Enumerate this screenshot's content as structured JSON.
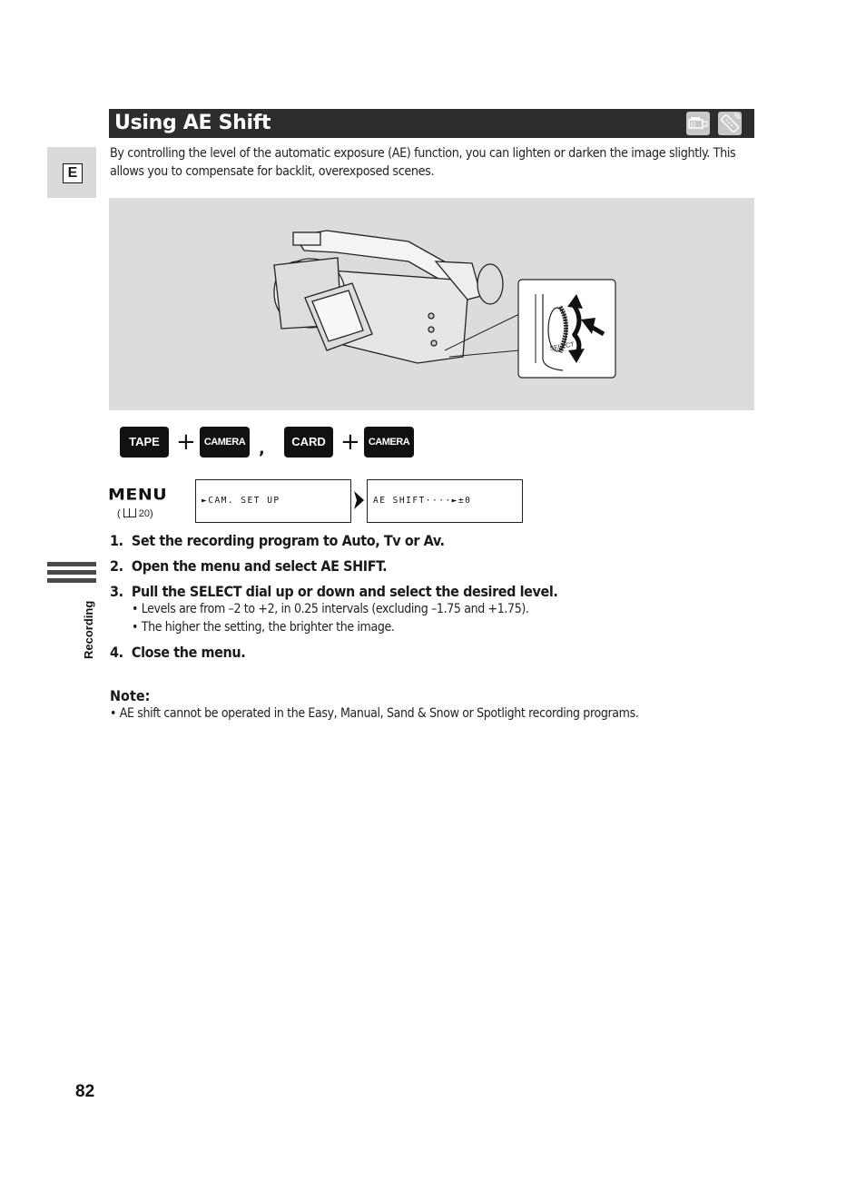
{
  "header": {
    "title": "Using AE Shift",
    "icons": [
      "camera-mode-icon",
      "remote-control-icon"
    ]
  },
  "language_tab": "E",
  "intro": "By controlling the level of the automatic exposure (AE) function, you can lighten or darken the image slightly. This allows you to compensate for backlit, overexposed scenes.",
  "illustration": {
    "description": "camcorder-with-select-dial-closeup",
    "dial_label": "SELECT"
  },
  "modes": {
    "group1": [
      "TAPE",
      "CAMERA"
    ],
    "group2": [
      "CARD",
      "CAMERA"
    ],
    "plus": "+",
    "separator": ","
  },
  "menu": {
    "label": "MENU",
    "reference": "( ☶ 20)",
    "ref_page": "20",
    "box1": "►CAM. SET UP",
    "box2": "AE SHIFT····►±0"
  },
  "steps": [
    {
      "num": "1.",
      "text": "Set the recording program to Auto, Tv or Av."
    },
    {
      "num": "2.",
      "text": "Open the menu and select AE SHIFT."
    },
    {
      "num": "3.",
      "text": "Pull the SELECT dial up or down and select the desired level."
    },
    {
      "num": "4.",
      "text": "Close the menu."
    }
  ],
  "step3_bullets": [
    "• Levels are from –2 to +2, in 0.25 intervals (excluding –1.75 and +1.75).",
    "• The higher the setting, the brighter the image."
  ],
  "side_label": "Recording",
  "note": {
    "heading": "Note:",
    "text": "• AE shift cannot be operated in the Easy, Manual, Sand & Snow or Spotlight recording programs."
  },
  "page_number": "82"
}
